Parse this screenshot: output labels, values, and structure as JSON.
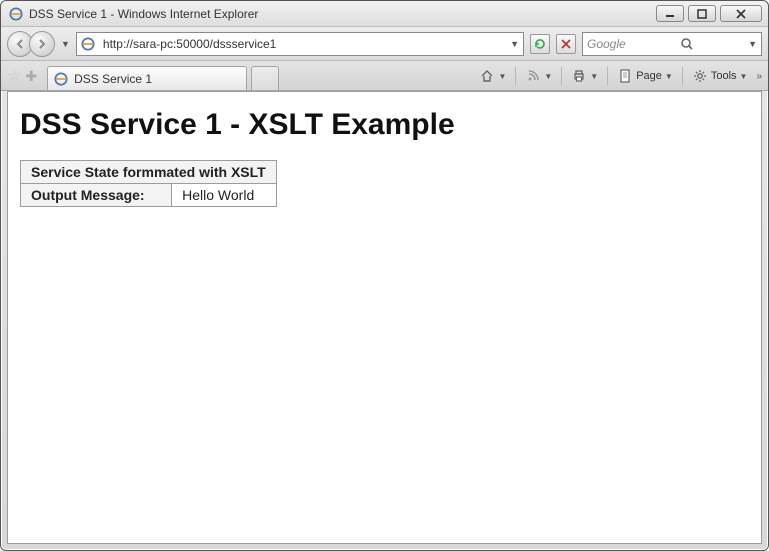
{
  "window": {
    "title": "DSS Service 1 - Windows Internet Explorer"
  },
  "address": {
    "url": "http://sara-pc:50000/dssservice1"
  },
  "search": {
    "placeholder": "Google"
  },
  "tab": {
    "label": "DSS Service 1"
  },
  "toolbar": {
    "page": "Page",
    "tools": "Tools"
  },
  "page": {
    "heading": "DSS Service 1 - XSLT Example",
    "table_header": "Service State formmated with XSLT",
    "row_label": "Output Message:",
    "row_value": "Hello World"
  }
}
